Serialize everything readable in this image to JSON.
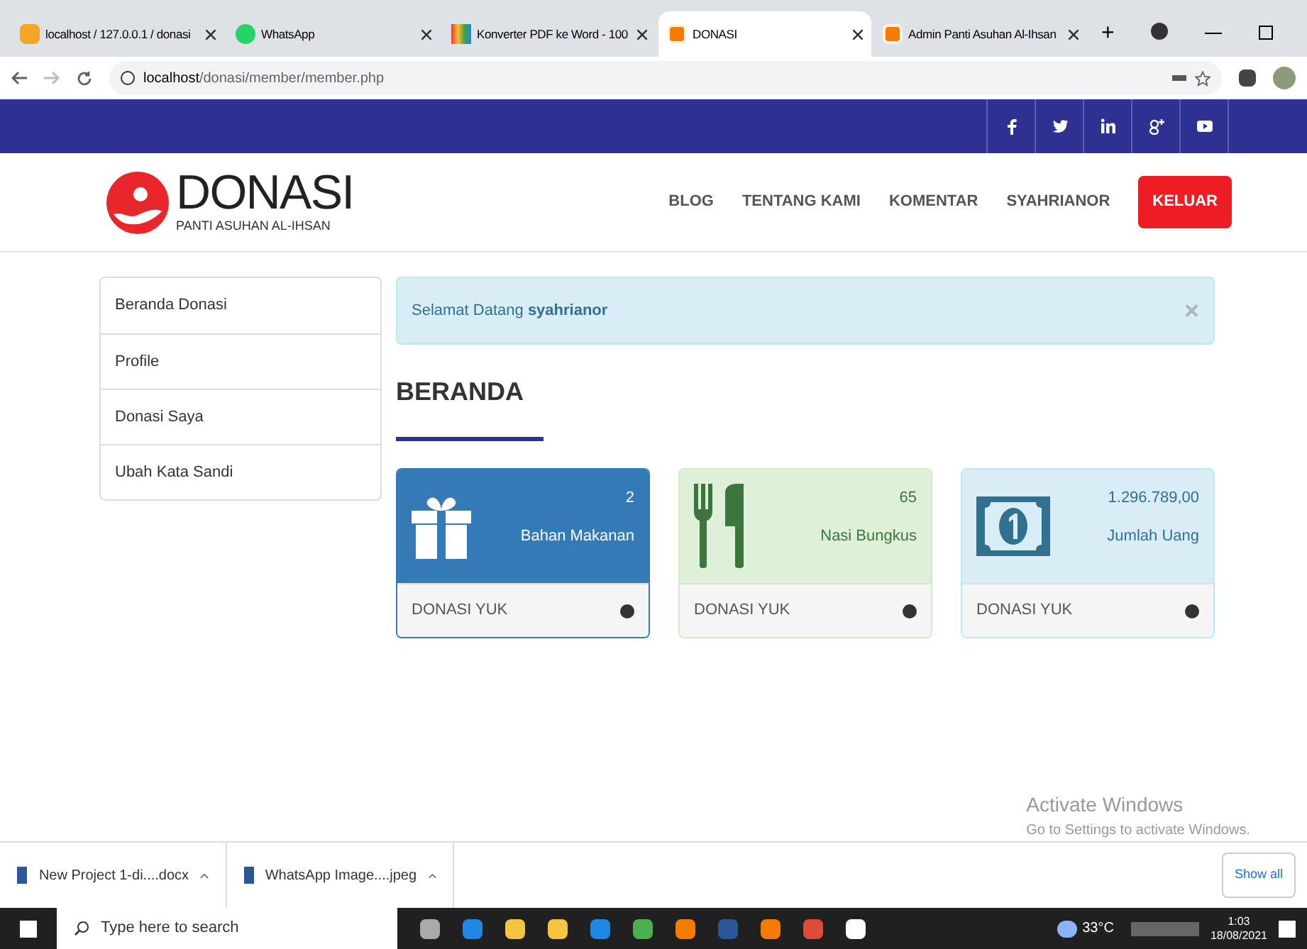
{
  "browser": {
    "tabs": [
      {
        "title": "localhost / 127.0.0.1 / donasi",
        "selected": false,
        "kind": "pma"
      },
      {
        "title": "WhatsApp",
        "selected": false,
        "kind": "whatsapp"
      },
      {
        "title": "Konverter PDF ke Word - 100",
        "selected": false,
        "kind": "pdf"
      },
      {
        "title": "DONASI",
        "selected": true,
        "kind": "xampp"
      },
      {
        "title": "Admin Panti Asuhan Al-Ihsan",
        "selected": false,
        "kind": "xampp"
      }
    ],
    "new_tab": "+",
    "url_host": "localhost",
    "url_path": "/donasi/member/member.php"
  },
  "header": {
    "logo_title": "DONASI",
    "logo_subtitle": "PANTI ASUHAN AL-IHSAN",
    "nav": [
      {
        "label": "BLOG",
        "kind": "link"
      },
      {
        "label": "TENTANG KAMI",
        "kind": "link"
      },
      {
        "label": "KOMENTAR",
        "kind": "link"
      },
      {
        "label": "SYAHRIANOR",
        "kind": "link"
      },
      {
        "label": "KELUAR",
        "kind": "button"
      }
    ]
  },
  "sidebar": {
    "items": [
      {
        "label": "Beranda Donasi"
      },
      {
        "label": "Profile"
      },
      {
        "label": "Donasi Saya"
      },
      {
        "label": "Ubah Kata Sandi"
      }
    ]
  },
  "alert": {
    "text": "Selamat Datang **syahrianor**",
    "close": "×"
  },
  "heading": "BERANDA",
  "cards": [
    {
      "kind": "gift",
      "value": "2",
      "label": "Bahan Makanan",
      "footer": "DONASI YUK"
    },
    {
      "kind": "food",
      "value": "65",
      "label": "Nasi Bungkus",
      "footer": "DONASI YUK"
    },
    {
      "kind": "money",
      "value": "1.296.789,00",
      "label": "Jumlah Uang",
      "footer": "DONASI YUK"
    }
  ],
  "activation": {
    "title": "Activate Windows",
    "text": "Go to Settings to activate Windows."
  },
  "downloads": {
    "items": [
      {
        "name": "New Project 1-di....docx"
      },
      {
        "name": "WhatsApp Image....jpeg"
      }
    ],
    "show_all": "Show all"
  },
  "taskbar": {
    "search_placeholder": "Type here to search",
    "temperature": "33°C",
    "time": "1:03",
    "date": "18/08/2021"
  }
}
